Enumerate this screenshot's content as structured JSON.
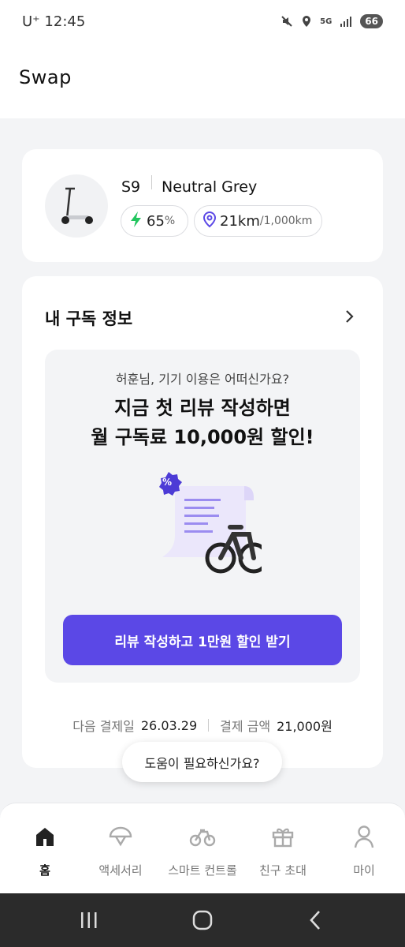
{
  "status_bar": {
    "carrier": "U⁺",
    "time": "12:45",
    "network": "5G",
    "battery": "66"
  },
  "header": {
    "logo": "Swap"
  },
  "device": {
    "model": "S9",
    "color_name": "Neutral Grey",
    "battery_value": "65",
    "battery_unit": "%",
    "distance_value": "21km",
    "distance_limit": "/1,000km",
    "accent_green": "#22c55e",
    "accent_purple": "#5b48e6"
  },
  "subscription": {
    "title": "내 구독 정보",
    "greeting": "허훈님, 기기 이용은 어떠신가요?",
    "promo_line1": "지금 첫 리뷰 작성하면",
    "promo_line2": "월 구독료 10,000원 할인!",
    "badge": "%",
    "cta_label": "리뷰 작성하고 1만원 할인 받기",
    "next_payment_label": "다음 결제일",
    "next_payment_value": "26.03.29",
    "amount_label": "결제 금액",
    "amount_value": "21,000원"
  },
  "help": {
    "label": "도움이 필요하신가요?"
  },
  "bottom_nav": {
    "items": [
      {
        "label": "홈",
        "icon": "home-icon",
        "active": true
      },
      {
        "label": "액세서리",
        "icon": "helmet-icon",
        "active": false
      },
      {
        "label": "스마트 컨트롤",
        "icon": "bike-icon",
        "active": false
      },
      {
        "label": "친구 초대",
        "icon": "gift-icon",
        "active": false
      },
      {
        "label": "마이",
        "icon": "person-icon",
        "active": false
      }
    ]
  }
}
